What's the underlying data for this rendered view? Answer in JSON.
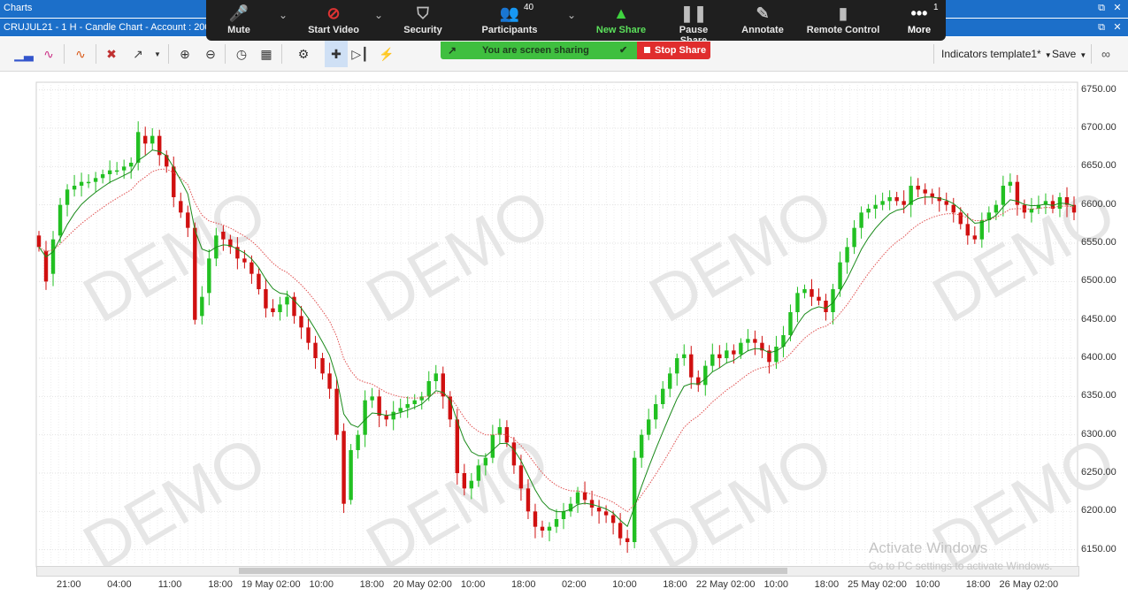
{
  "window": {
    "title": "Charts"
  },
  "chart_window": {
    "title": "CRUJUL21 - 1 H - Candle Chart - Account : 200032"
  },
  "zoom_toolbar": {
    "items": [
      {
        "label": "Mute",
        "icon": "microphone-icon"
      },
      {
        "label": "Start Video",
        "icon": "video-off-icon"
      },
      {
        "label": "Security",
        "icon": "shield-icon"
      },
      {
        "label": "Participants",
        "icon": "participants-icon",
        "badge": "40"
      },
      {
        "label": "New Share",
        "icon": "share-up-icon"
      },
      {
        "label": "Pause Share",
        "icon": "pause-icon"
      },
      {
        "label": "Annotate",
        "icon": "pencil-icon"
      },
      {
        "label": "Remote Control",
        "icon": "mouse-icon"
      },
      {
        "label": "More",
        "icon": "more-dots-icon",
        "badge": "1"
      }
    ],
    "share_status": "You are screen sharing",
    "stop_share": "Stop Share"
  },
  "chart_toolbar": {
    "template_label": "Indicators template1*",
    "save_label": "Save"
  },
  "watermark": {
    "text": "DEMO",
    "os_activate_title": "Activate Windows",
    "os_activate_sub": "Go to PC settings to activate Windows."
  },
  "chart_data": {
    "type": "candlestick",
    "ylim": [
      6130,
      6760
    ],
    "y_ticks": [
      "6750.00",
      "6700.00",
      "6650.00",
      "6600.00",
      "6550.00",
      "6500.00",
      "6450.00",
      "6400.00",
      "6350.00",
      "6300.00",
      "6250.00",
      "6200.00",
      "6150.00"
    ],
    "x_ticks": [
      "21:00",
      "04:00",
      "11:00",
      "18:00",
      "19 May 02:00",
      "10:00",
      "18:00",
      "20 May 02:00",
      "10:00",
      "18:00",
      "02:00",
      "10:00",
      "18:00",
      "22 May 02:00",
      "10:00",
      "18:00",
      "25 May 02:00",
      "10:00",
      "18:00",
      "26 May 02:00"
    ],
    "close_values": [
      6545,
      6500,
      6555,
      6600,
      6620,
      6625,
      6630,
      6630,
      6635,
      6640,
      6645,
      6645,
      6650,
      6655,
      6695,
      6680,
      6690,
      6665,
      6650,
      6610,
      6590,
      6570,
      6450,
      6480,
      6530,
      6560,
      6555,
      6545,
      6530,
      6525,
      6510,
      6490,
      6465,
      6460,
      6470,
      6480,
      6455,
      6440,
      6420,
      6400,
      6380,
      6360,
      6300,
      6210,
      6280,
      6300,
      6345,
      6350,
      6325,
      6320,
      6330,
      6335,
      6340,
      6345,
      6350,
      6370,
      6380,
      6350,
      6320,
      6250,
      6230,
      6240,
      6260,
      6270,
      6300,
      6310,
      6290,
      6260,
      6230,
      6200,
      6180,
      6175,
      6180,
      6190,
      6200,
      6210,
      6225,
      6215,
      6205,
      6200,
      6195,
      6185,
      6165,
      6160,
      6270,
      6300,
      6320,
      6340,
      6360,
      6380,
      6400,
      6405,
      6375,
      6365,
      6390,
      6405,
      6400,
      6410,
      6405,
      6420,
      6425,
      6420,
      6410,
      6395,
      6415,
      6430,
      6460,
      6485,
      6490,
      6480,
      6475,
      6460,
      6490,
      6525,
      6545,
      6570,
      6590,
      6595,
      6600,
      6605,
      6610,
      6605,
      6600,
      6625,
      6620,
      6615,
      6610,
      6605,
      6600,
      6590,
      6575,
      6560,
      6555,
      6580,
      6590,
      6600,
      6625,
      6630,
      6600,
      6590,
      6595,
      6600,
      6605,
      6595,
      6610,
      6600,
      6590
    ],
    "open_values": [
      6560,
      6540,
      6510,
      6560,
      6600,
      6620,
      6625,
      6630,
      6630,
      6635,
      6640,
      6645,
      6645,
      6650,
      6655,
      6690,
      6680,
      6690,
      6665,
      6650,
      6605,
      6590,
      6570,
      6455,
      6485,
      6530,
      6565,
      6555,
      6545,
      6530,
      6525,
      6510,
      6490,
      6465,
      6460,
      6470,
      6480,
      6455,
      6440,
      6420,
      6400,
      6380,
      6360,
      6305,
      6215,
      6280,
      6300,
      6345,
      6350,
      6325,
      6320,
      6330,
      6335,
      6340,
      6345,
      6350,
      6370,
      6380,
      6350,
      6320,
      6250,
      6230,
      6240,
      6260,
      6270,
      6300,
      6310,
      6290,
      6260,
      6230,
      6200,
      6180,
      6175,
      6180,
      6190,
      6200,
      6210,
      6225,
      6215,
      6205,
      6200,
      6195,
      6185,
      6165,
      6160,
      6270,
      6300,
      6320,
      6340,
      6360,
      6380,
      6400,
      6405,
      6375,
      6365,
      6390,
      6405,
      6400,
      6410,
      6405,
      6420,
      6425,
      6420,
      6410,
      6395,
      6415,
      6430,
      6460,
      6485,
      6490,
      6480,
      6475,
      6460,
      6490,
      6525,
      6545,
      6570,
      6590,
      6595,
      6600,
      6605,
      6610,
      6605,
      6600,
      6625,
      6620,
      6615,
      6610,
      6605,
      6600,
      6590,
      6575,
      6560,
      6555,
      6580,
      6590,
      6600,
      6625,
      6630,
      6600,
      6590,
      6595,
      6600,
      6605,
      6595,
      6610,
      6600
    ],
    "series": [
      {
        "name": "",
        "color": "#1a8a1a"
      },
      {
        "name": "",
        "color": "#e05050"
      }
    ],
    "colors": {
      "up": "#22c022",
      "down": "#d01010"
    },
    "grid": true,
    "watermark_text": "DEMO"
  }
}
